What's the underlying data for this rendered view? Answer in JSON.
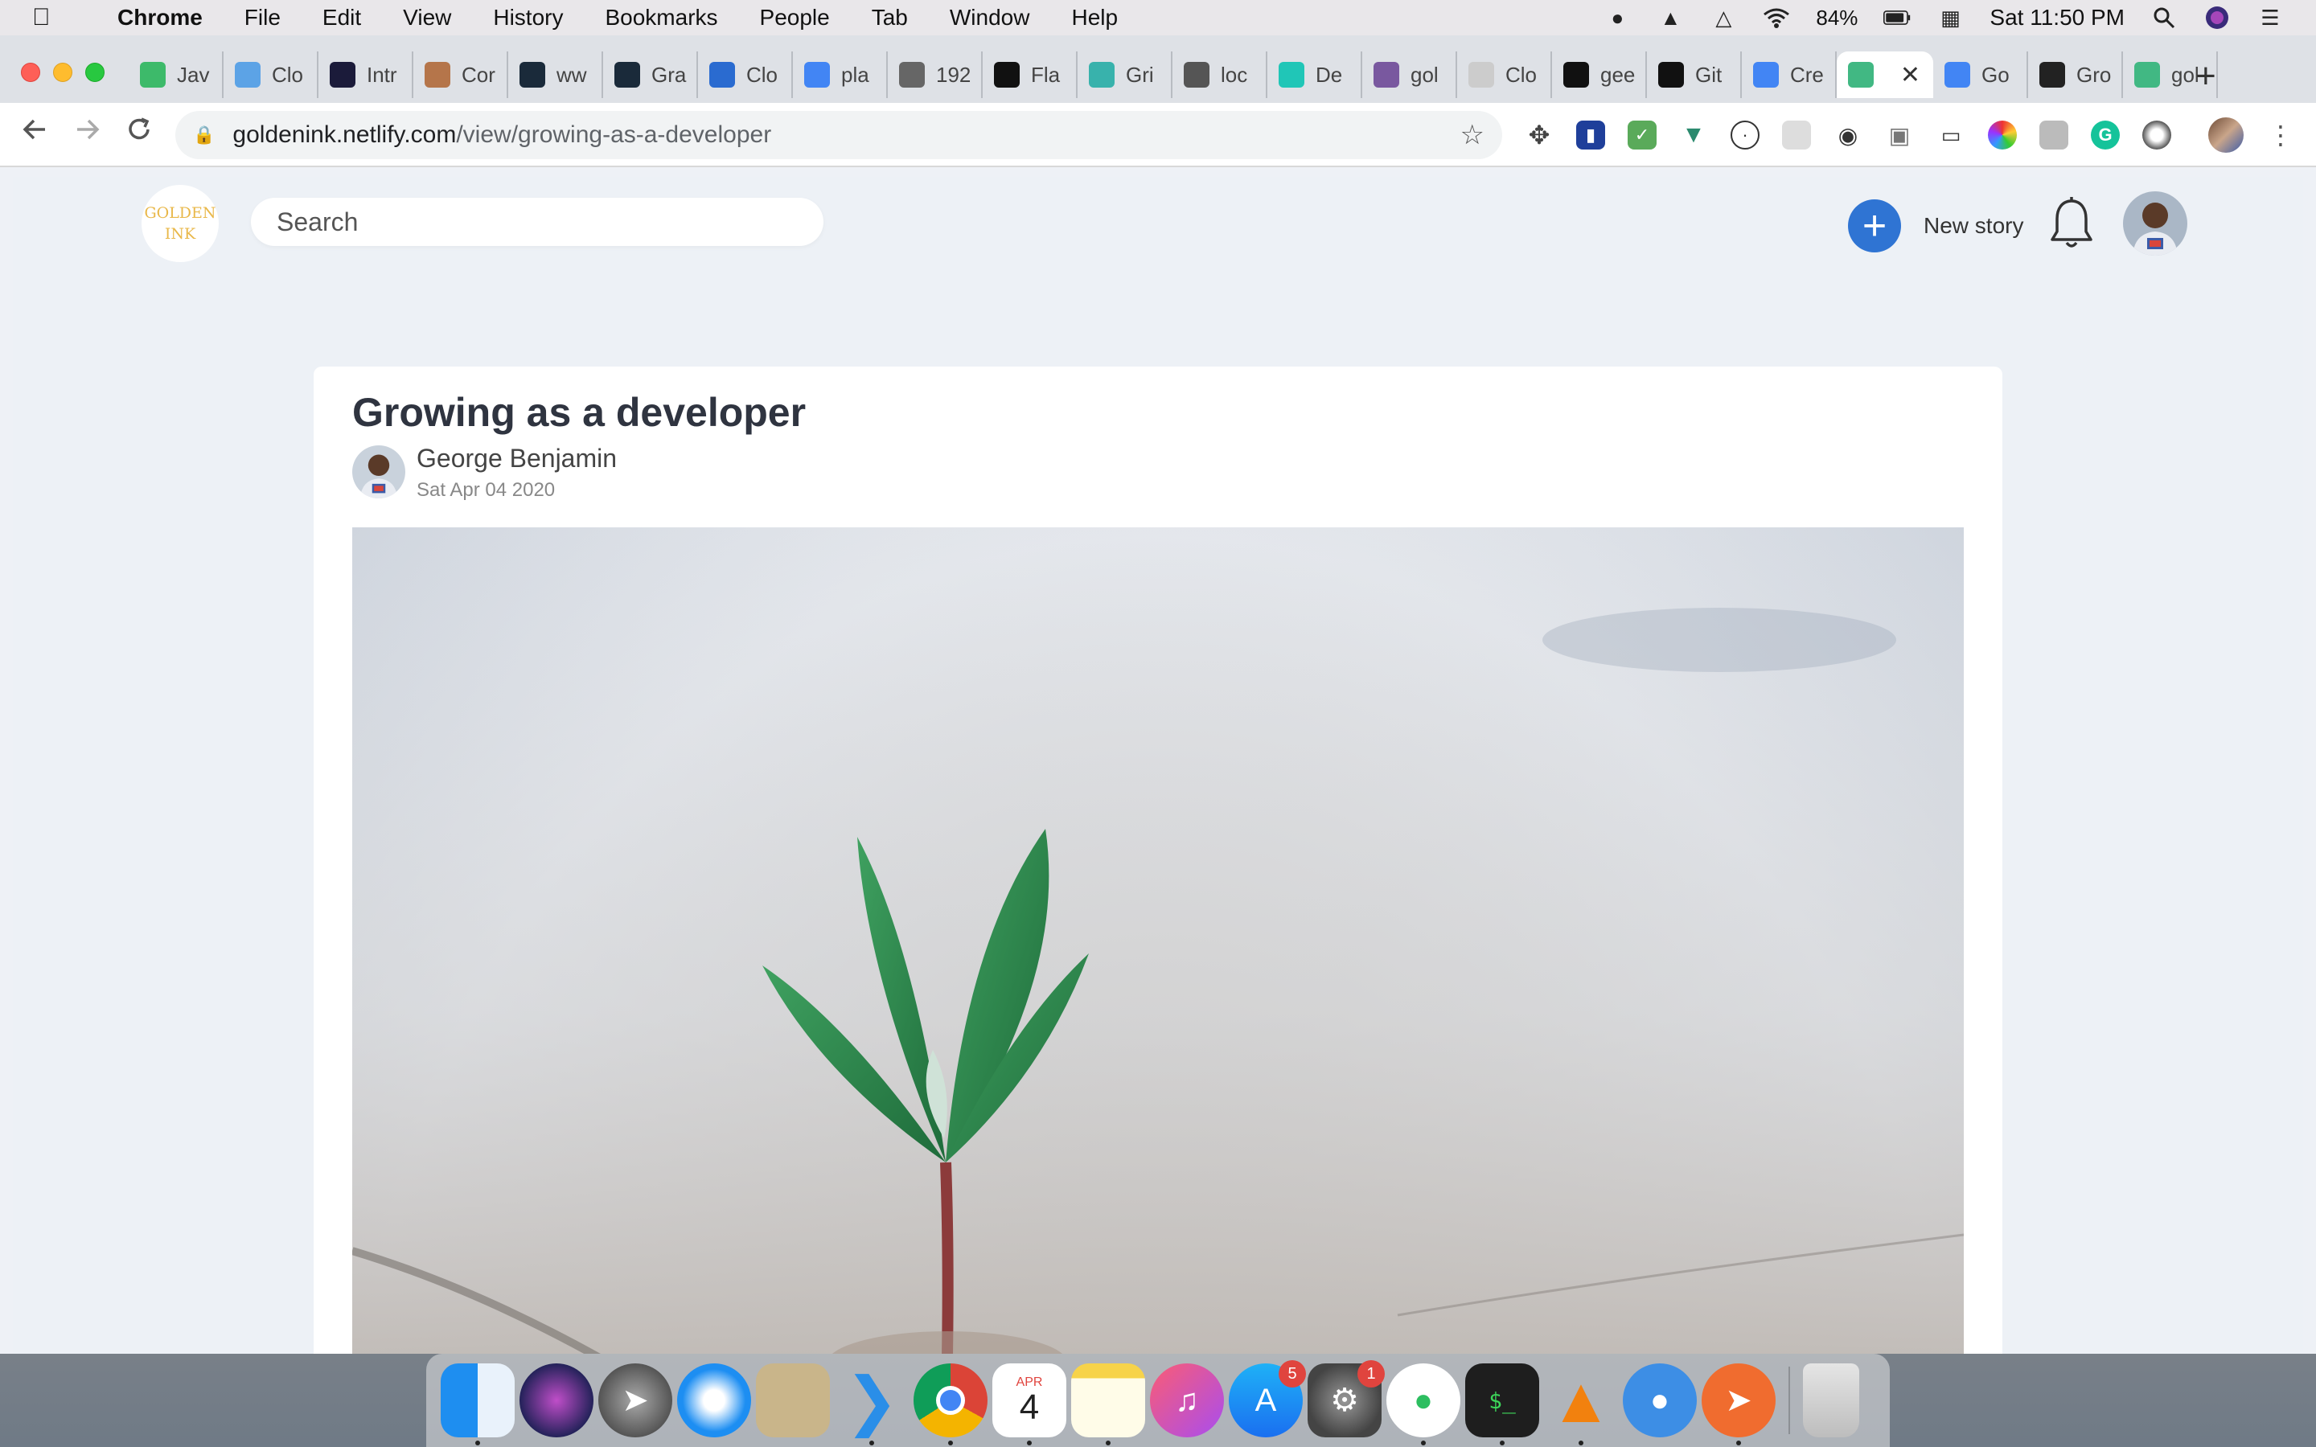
{
  "menubar": {
    "app_name": "Chrome",
    "items": [
      "File",
      "Edit",
      "View",
      "History",
      "Bookmarks",
      "People",
      "Tab",
      "Window",
      "Help"
    ],
    "battery": "84%",
    "clock": "Sat 11:50 PM"
  },
  "tabs": [
    {
      "label": "Jav",
      "icon": "generic-favicon",
      "color": "#3dba6a"
    },
    {
      "label": "Clo",
      "icon": "cloud-favicon",
      "color": "#5ca3e6"
    },
    {
      "label": "Intr",
      "icon": "generic-favicon",
      "color": "#1b1b3a"
    },
    {
      "label": "Cor",
      "icon": "generic-favicon",
      "color": "#b5754a"
    },
    {
      "label": "ww",
      "icon": "prisma-favicon",
      "color": "#1a2a3a"
    },
    {
      "label": "Gra",
      "icon": "prisma-favicon",
      "color": "#1a2a3a"
    },
    {
      "label": "Clo",
      "icon": "cloud-favicon",
      "color": "#2a6bd0"
    },
    {
      "label": "pla",
      "icon": "google-favicon",
      "color": "#4285f4"
    },
    {
      "label": "192",
      "icon": "globe-favicon",
      "color": "#666666"
    },
    {
      "label": "Fla",
      "icon": "dev-favicon",
      "color": "#111111"
    },
    {
      "label": "Gri",
      "icon": "tailwind-favicon",
      "color": "#38b2ac"
    },
    {
      "label": "loc",
      "icon": "vue-favicon",
      "color": "#555555"
    },
    {
      "label": "De",
      "icon": "netlify-favicon",
      "color": "#20c6b7"
    },
    {
      "label": "gol",
      "icon": "heroku-favicon",
      "color": "#79589f"
    },
    {
      "label": "Clo",
      "icon": "generic-favicon",
      "color": "#cccccc"
    },
    {
      "label": "gee",
      "icon": "generic-favicon",
      "color": "#111111"
    },
    {
      "label": "Git",
      "icon": "github-favicon",
      "color": "#111111"
    },
    {
      "label": "Cre",
      "icon": "google-favicon",
      "color": "#4285f4"
    },
    {
      "label": "",
      "icon": "vue-favicon",
      "color": "#41b883",
      "active": true
    },
    {
      "label": "Go",
      "icon": "google-favicon",
      "color": "#4285f4"
    },
    {
      "label": "Gro",
      "icon": "generic-favicon",
      "color": "#222222"
    },
    {
      "label": "gol",
      "icon": "vue-favicon",
      "color": "#41b883"
    }
  ],
  "address": {
    "host": "goldenink.netlify.com",
    "path": "/view/growing-as-a-developer"
  },
  "site": {
    "logo_line1": "GOLDEN",
    "logo_line2": "INK",
    "search_placeholder": "Search",
    "new_story_label": "New story"
  },
  "article": {
    "title": "Growing as a developer",
    "author": "George Benjamin",
    "date": "Sat Apr 04 2020",
    "hero_subject": "seedling sprouting from concrete"
  },
  "dock": {
    "calendar_month": "APR",
    "calendar_day": "4",
    "app_store_badge": "5",
    "system_prefs_badge": "1"
  },
  "colors": {
    "accent": "#2f74d3",
    "logo_gold": "#e9b84a",
    "page_bg": "#edf1f6"
  }
}
